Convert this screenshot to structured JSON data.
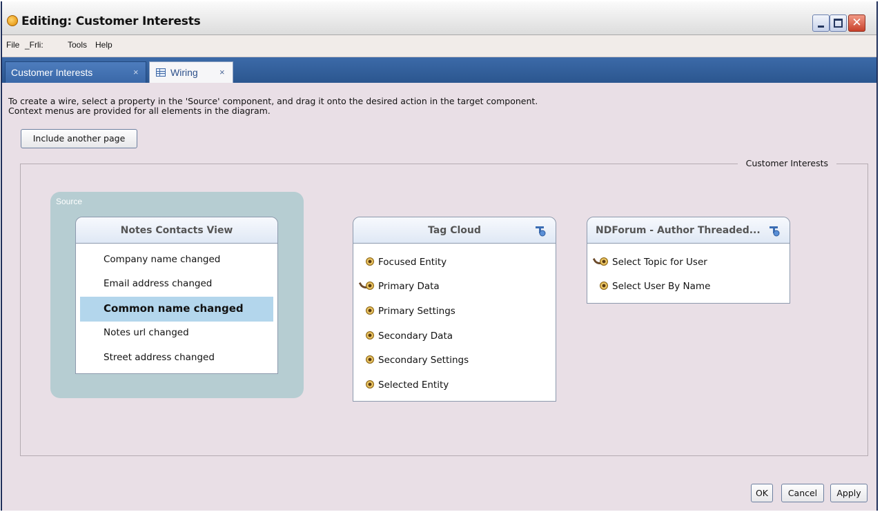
{
  "window": {
    "title": "Editing: Customer Interests"
  },
  "menu": [
    "File",
    "_Frli:",
    "Tools",
    "Help"
  ],
  "tabs": [
    {
      "label": "Customer Interests",
      "close": "×",
      "active": false
    },
    {
      "label": "Wiring",
      "close": "×",
      "active": true,
      "icon": "table-icon"
    }
  ],
  "instructions": {
    "line1": "To create a wire, select a property in the 'Source' component, and drag it onto the desired action in the target component.",
    "line2": "Context menus are provided for all elements in the diagram."
  },
  "include_button": "Include another page",
  "group_label": "Customer Interests",
  "source": {
    "label": "Source",
    "component": {
      "title": "Notes Contacts View",
      "properties": [
        {
          "label": "Company name changed",
          "selected": false
        },
        {
          "label": "Email address changed",
          "selected": false
        },
        {
          "label": "Common name changed",
          "selected": true
        },
        {
          "label": "Notes url changed",
          "selected": false
        },
        {
          "label": "Street address changed",
          "selected": false
        }
      ]
    }
  },
  "targets": [
    {
      "title": "Tag Cloud",
      "actions": [
        {
          "label": "Focused Entity",
          "wired": false
        },
        {
          "label": "Primary Data",
          "wired": true
        },
        {
          "label": "Primary Settings",
          "wired": false
        },
        {
          "label": "Secondary Data",
          "wired": false
        },
        {
          "label": "Secondary Settings",
          "wired": false
        },
        {
          "label": "Selected Entity",
          "wired": false
        }
      ]
    },
    {
      "title": "NDForum - Author Threaded...",
      "actions": [
        {
          "label": "Select Topic for User",
          "wired": true
        },
        {
          "label": "Select User By Name",
          "wired": false
        }
      ]
    }
  ],
  "footer": {
    "ok": "OK",
    "cancel": "Cancel",
    "apply": "Apply"
  }
}
